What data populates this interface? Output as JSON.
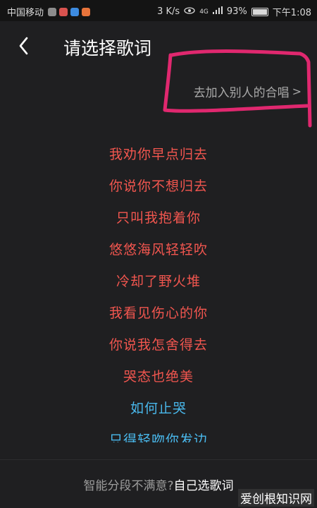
{
  "status_bar": {
    "carrier": "中国移动",
    "speed": "3 K/s",
    "network": "4G",
    "battery": "93%",
    "time": "下午1:08",
    "app_icons": [
      {
        "name": "app-icon-1",
        "color": "#8c8c8c"
      },
      {
        "name": "app-icon-2",
        "color": "#d9534f"
      },
      {
        "name": "app-icon-3",
        "color": "#3d8be0"
      },
      {
        "name": "app-icon-4",
        "color": "#e8743b"
      }
    ]
  },
  "header": {
    "back_icon": "chevron-left-icon",
    "title": "请选择歌词"
  },
  "join_link": {
    "label": "去加入别人的合唱",
    "chevron": ">"
  },
  "annotation_color": "#e0286f",
  "lyrics": [
    {
      "text": "我劝你早点归去",
      "color": "red"
    },
    {
      "text": "你说你不想归去",
      "color": "red"
    },
    {
      "text": "只叫我抱着你",
      "color": "red"
    },
    {
      "text": "悠悠海风轻轻吹",
      "color": "red"
    },
    {
      "text": "冷却了野火堆",
      "color": "red"
    },
    {
      "text": "我看见伤心的你",
      "color": "red"
    },
    {
      "text": "你说我怎舍得去",
      "color": "red"
    },
    {
      "text": "哭态也绝美",
      "color": "red"
    },
    {
      "text": "如何止哭",
      "color": "blue"
    },
    {
      "text": "只得轻吻你发边",
      "color": "blue"
    }
  ],
  "footer": {
    "question": "智能分段不满意?",
    "action": "自己选歌词"
  },
  "watermark": "爱创根知识网"
}
